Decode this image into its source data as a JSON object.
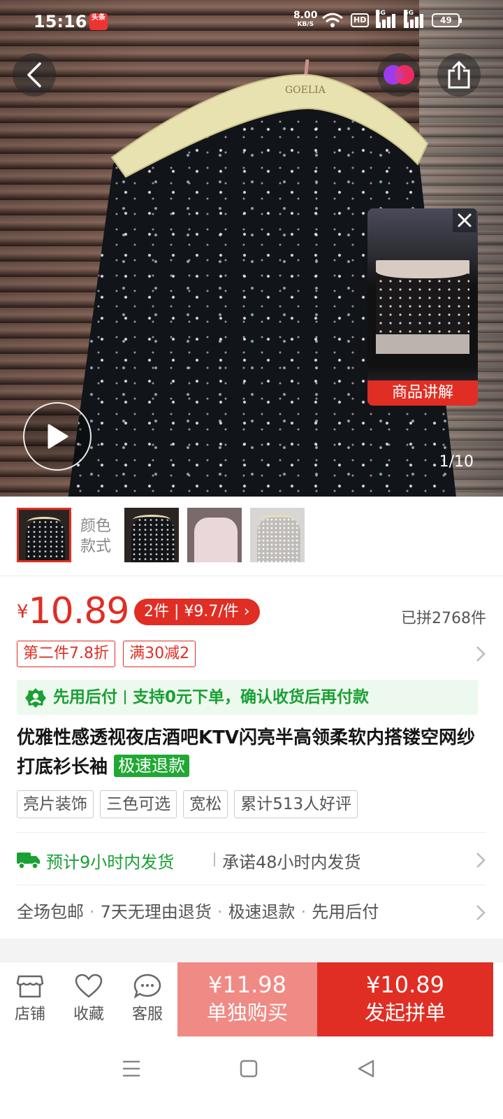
{
  "status_bar": {
    "time": "15:16",
    "app_badge": "头条",
    "net_speed_value": "8.00",
    "net_speed_unit": "KB/S",
    "hd_label": "HD",
    "net1": "4G",
    "net2": "5G",
    "battery": "49"
  },
  "hero": {
    "hanger_brand": "GOELIA",
    "page_indicator": "1/10",
    "live_label": "商品讲解"
  },
  "sku": {
    "label_line1": "颜色",
    "label_line2": "款式"
  },
  "price": {
    "currency": "¥",
    "value": "10.89",
    "multi_tag": "2件 | ¥9.7/件 ›",
    "sold": "已拼2768件"
  },
  "promos": [
    "第二件7.8折",
    "满30减2"
  ],
  "pay_after": {
    "part1": "先用后付",
    "part2": "支持0元下单，确认收货后再付款"
  },
  "product": {
    "title": "优雅性感透视夜店酒吧KTV闪亮半高领柔软内搭镂空网纱打底衫长袖",
    "refund_tag": "极速退款"
  },
  "features": [
    "亮片装饰",
    "三色可选",
    "宽松",
    "累计513人好评"
  ],
  "shipping": {
    "main": "预计9小时内发货",
    "sub": "承诺48小时内发货"
  },
  "guarantees": [
    "全场包邮",
    "7天无理由退货",
    "极速退款",
    "先用后付"
  ],
  "bottom_bar": {
    "store": "店铺",
    "favorite": "收藏",
    "service": "客服",
    "alone_price": "¥11.98",
    "alone_label": "单独购买",
    "group_price": "¥10.89",
    "group_label": "发起拼单"
  },
  "colors": {
    "accent_red": "#e02e24",
    "green": "#1aa034",
    "alone_button": "#f08a84"
  }
}
